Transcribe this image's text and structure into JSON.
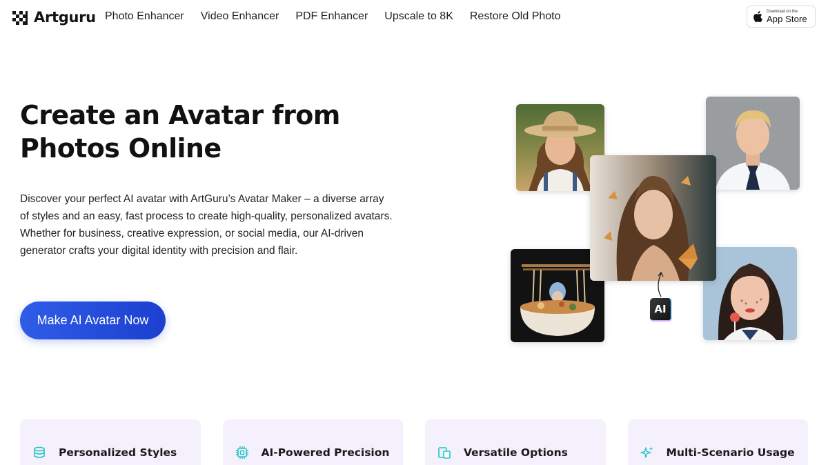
{
  "brand": {
    "name": "Artguru"
  },
  "nav": {
    "items": [
      {
        "label": "Photo Enhancer"
      },
      {
        "label": "Video Enhancer"
      },
      {
        "label": "PDF Enhancer"
      },
      {
        "label": "Upscale to 8K"
      },
      {
        "label": "Restore Old Photo"
      }
    ]
  },
  "appstore": {
    "small": "Download on the",
    "big": "App Store"
  },
  "hero": {
    "title_line1": "Create an Avatar from",
    "title_line2": "Photos Online",
    "description": "Discover your perfect AI avatar with ArtGuru’s Avatar Maker – a diverse array of styles and an easy, fast process to create high-quality, personalized avatars. Whether for business, creative expression, or social media, our AI-driven generator crafts your digital identity with precision and flair.",
    "cta_label": "Make AI Avatar Now",
    "ai_badge": "AI"
  },
  "features": [
    {
      "label": "Personalized Styles",
      "icon": "database-icon"
    },
    {
      "label": "AI-Powered Precision",
      "icon": "chip-icon"
    },
    {
      "label": "Versatile Options",
      "icon": "devices-icon"
    },
    {
      "label": "Multi-Scenario Usage",
      "icon": "sparkles-icon"
    }
  ],
  "colors": {
    "accent": "#2f5de8",
    "card_bg": "#f4f0fc",
    "icon_teal": "#1fc6c6"
  }
}
